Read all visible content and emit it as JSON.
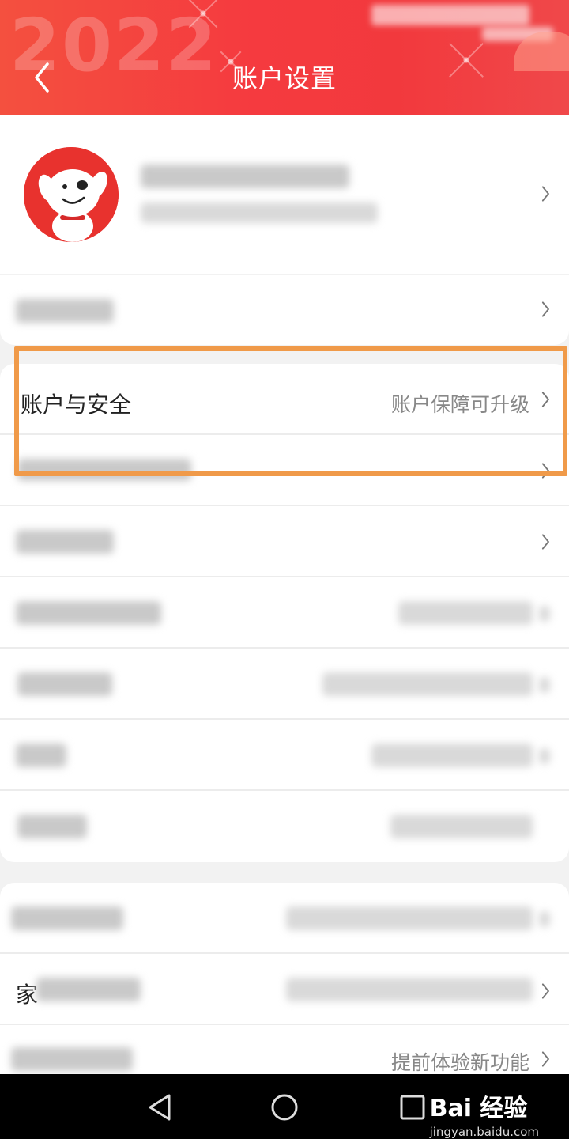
{
  "header": {
    "title": "账户设置",
    "back_icon": "chevron-left-icon",
    "decor_year": "2022",
    "background_color": "#f53a3f"
  },
  "profile": {
    "avatar": "joy-dog-avatar",
    "chevron_icon": "chevron-right-icon"
  },
  "settings": {
    "account_security": {
      "label": "账户与安全",
      "value": "账户保障可升级"
    },
    "hidden_rows": [
      "address-row",
      "row-3",
      "row-4",
      "row-5",
      "row-6",
      "row-7",
      "row-8"
    ],
    "last_row_value": "提前体验新功能",
    "family_row_prefix": "家"
  },
  "highlight": {
    "color": "#f09a49"
  },
  "navbar": {
    "back_icon": "triangle-back-icon",
    "home_icon": "circle-home-icon",
    "recents_icon": "square-recents-icon"
  },
  "watermark": {
    "main": "Bai 经验",
    "sub": "jingyan.baidu.com"
  }
}
